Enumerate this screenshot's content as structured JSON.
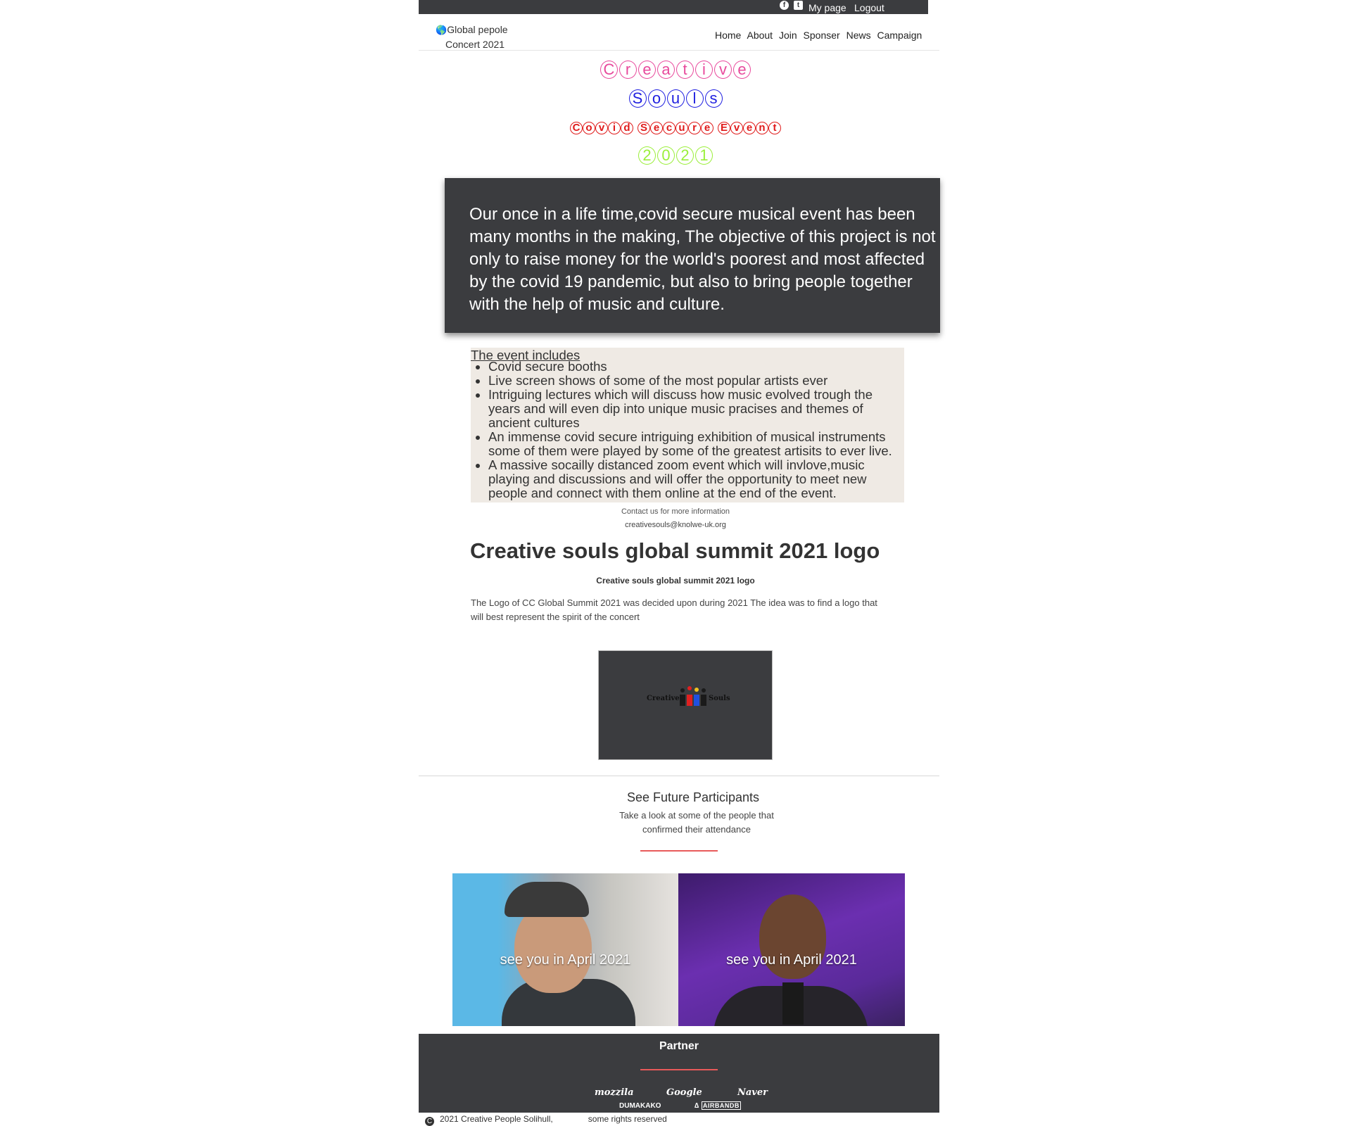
{
  "topbar": {
    "facebook_icon": "facebook-icon",
    "twitter_icon": "twitter-icon",
    "my_page": "My page",
    "logout": "Logout"
  },
  "header": {
    "brand_line1": "Global pepole",
    "brand_line2": "Concert 2021",
    "nav": [
      "Home",
      "About",
      "Join",
      "Sponser",
      "News",
      "Campaign"
    ]
  },
  "titles": {
    "line1": "Creative",
    "line2": "Souls",
    "line3": "Covid Secure Event",
    "line4": "2021",
    "colors": {
      "line1": "#e8499c",
      "line2": "#1e1ee0",
      "line3": "#e01a1a",
      "line4": "#9bef3a"
    }
  },
  "intro": {
    "text": "Our once in a life time,covid secure musical event has been many months in the making, The objective of this project is not only to raise money for the world's poorest and most affected by the covid 19 pandemic, but also to bring people together with the help of music and culture."
  },
  "events": {
    "heading": "The event includes",
    "items": [
      "Covid secure booths",
      "Live screen shows of some of the most popular artists ever",
      "Intriguing lectures which will discuss how music evolved trough the years and will even dip into unique music pracises and themes of ancient cultures",
      "An immense covid secure intriguing exhibition of musical instruments some of them were played by some of the greatest artisits to ever live.",
      "A massive socailly distanced zoom event which will invlove,music playing and discussions and will offer the opportunity to meet new people and connect with them online at the end of the event."
    ]
  },
  "contact": {
    "line1": "Contact us for more information",
    "email": "creativesouls@knolwe-uk.org"
  },
  "logo_section": {
    "title": "Creative souls global summit 2021 logo",
    "subtitle": "Creative souls global summit 2021 logo",
    "description": "The Logo of CC Global Summit 2021 was decided upon during 2021 The idea was to find a logo that will best represent the spirit of the concert",
    "logo_word_left": "Creative",
    "logo_word_right": "Souls"
  },
  "participants": {
    "title": "See Future Participants",
    "description": "Take a look at some of the people that confirmed their attendance",
    "cards": [
      {
        "caption": "see you in April 2021"
      },
      {
        "caption": "see you in April 2021"
      }
    ]
  },
  "partner": {
    "title": "Partner",
    "logos": [
      "mozzila",
      "Google",
      "Naver",
      "DUMAKAKO",
      "AIRBANDB"
    ]
  },
  "footer": {
    "copyright": "2021 Creative People Solihull,",
    "rights": "some rights reserved"
  }
}
